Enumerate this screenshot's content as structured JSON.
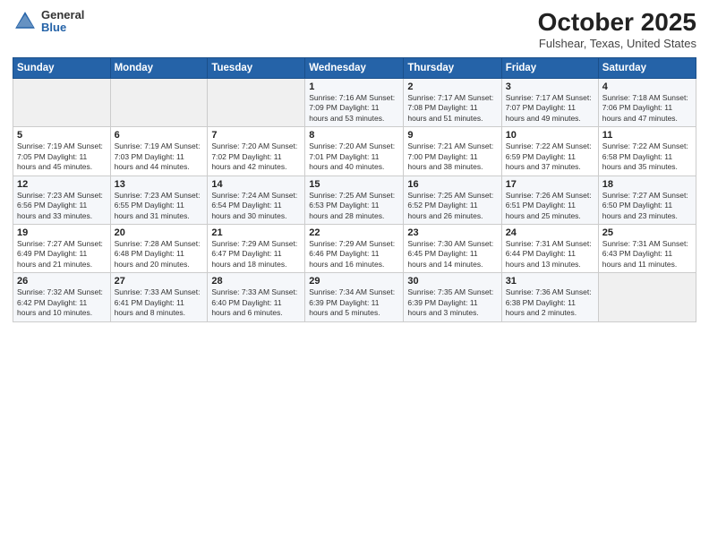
{
  "header": {
    "logo_general": "General",
    "logo_blue": "Blue",
    "month": "October 2025",
    "location": "Fulshear, Texas, United States"
  },
  "days_of_week": [
    "Sunday",
    "Monday",
    "Tuesday",
    "Wednesday",
    "Thursday",
    "Friday",
    "Saturday"
  ],
  "weeks": [
    [
      {
        "num": "",
        "info": ""
      },
      {
        "num": "",
        "info": ""
      },
      {
        "num": "",
        "info": ""
      },
      {
        "num": "1",
        "info": "Sunrise: 7:16 AM\nSunset: 7:09 PM\nDaylight: 11 hours and 53 minutes."
      },
      {
        "num": "2",
        "info": "Sunrise: 7:17 AM\nSunset: 7:08 PM\nDaylight: 11 hours and 51 minutes."
      },
      {
        "num": "3",
        "info": "Sunrise: 7:17 AM\nSunset: 7:07 PM\nDaylight: 11 hours and 49 minutes."
      },
      {
        "num": "4",
        "info": "Sunrise: 7:18 AM\nSunset: 7:06 PM\nDaylight: 11 hours and 47 minutes."
      }
    ],
    [
      {
        "num": "5",
        "info": "Sunrise: 7:19 AM\nSunset: 7:05 PM\nDaylight: 11 hours and 45 minutes."
      },
      {
        "num": "6",
        "info": "Sunrise: 7:19 AM\nSunset: 7:03 PM\nDaylight: 11 hours and 44 minutes."
      },
      {
        "num": "7",
        "info": "Sunrise: 7:20 AM\nSunset: 7:02 PM\nDaylight: 11 hours and 42 minutes."
      },
      {
        "num": "8",
        "info": "Sunrise: 7:20 AM\nSunset: 7:01 PM\nDaylight: 11 hours and 40 minutes."
      },
      {
        "num": "9",
        "info": "Sunrise: 7:21 AM\nSunset: 7:00 PM\nDaylight: 11 hours and 38 minutes."
      },
      {
        "num": "10",
        "info": "Sunrise: 7:22 AM\nSunset: 6:59 PM\nDaylight: 11 hours and 37 minutes."
      },
      {
        "num": "11",
        "info": "Sunrise: 7:22 AM\nSunset: 6:58 PM\nDaylight: 11 hours and 35 minutes."
      }
    ],
    [
      {
        "num": "12",
        "info": "Sunrise: 7:23 AM\nSunset: 6:56 PM\nDaylight: 11 hours and 33 minutes."
      },
      {
        "num": "13",
        "info": "Sunrise: 7:23 AM\nSunset: 6:55 PM\nDaylight: 11 hours and 31 minutes."
      },
      {
        "num": "14",
        "info": "Sunrise: 7:24 AM\nSunset: 6:54 PM\nDaylight: 11 hours and 30 minutes."
      },
      {
        "num": "15",
        "info": "Sunrise: 7:25 AM\nSunset: 6:53 PM\nDaylight: 11 hours and 28 minutes."
      },
      {
        "num": "16",
        "info": "Sunrise: 7:25 AM\nSunset: 6:52 PM\nDaylight: 11 hours and 26 minutes."
      },
      {
        "num": "17",
        "info": "Sunrise: 7:26 AM\nSunset: 6:51 PM\nDaylight: 11 hours and 25 minutes."
      },
      {
        "num": "18",
        "info": "Sunrise: 7:27 AM\nSunset: 6:50 PM\nDaylight: 11 hours and 23 minutes."
      }
    ],
    [
      {
        "num": "19",
        "info": "Sunrise: 7:27 AM\nSunset: 6:49 PM\nDaylight: 11 hours and 21 minutes."
      },
      {
        "num": "20",
        "info": "Sunrise: 7:28 AM\nSunset: 6:48 PM\nDaylight: 11 hours and 20 minutes."
      },
      {
        "num": "21",
        "info": "Sunrise: 7:29 AM\nSunset: 6:47 PM\nDaylight: 11 hours and 18 minutes."
      },
      {
        "num": "22",
        "info": "Sunrise: 7:29 AM\nSunset: 6:46 PM\nDaylight: 11 hours and 16 minutes."
      },
      {
        "num": "23",
        "info": "Sunrise: 7:30 AM\nSunset: 6:45 PM\nDaylight: 11 hours and 14 minutes."
      },
      {
        "num": "24",
        "info": "Sunrise: 7:31 AM\nSunset: 6:44 PM\nDaylight: 11 hours and 13 minutes."
      },
      {
        "num": "25",
        "info": "Sunrise: 7:31 AM\nSunset: 6:43 PM\nDaylight: 11 hours and 11 minutes."
      }
    ],
    [
      {
        "num": "26",
        "info": "Sunrise: 7:32 AM\nSunset: 6:42 PM\nDaylight: 11 hours and 10 minutes."
      },
      {
        "num": "27",
        "info": "Sunrise: 7:33 AM\nSunset: 6:41 PM\nDaylight: 11 hours and 8 minutes."
      },
      {
        "num": "28",
        "info": "Sunrise: 7:33 AM\nSunset: 6:40 PM\nDaylight: 11 hours and 6 minutes."
      },
      {
        "num": "29",
        "info": "Sunrise: 7:34 AM\nSunset: 6:39 PM\nDaylight: 11 hours and 5 minutes."
      },
      {
        "num": "30",
        "info": "Sunrise: 7:35 AM\nSunset: 6:39 PM\nDaylight: 11 hours and 3 minutes."
      },
      {
        "num": "31",
        "info": "Sunrise: 7:36 AM\nSunset: 6:38 PM\nDaylight: 11 hours and 2 minutes."
      },
      {
        "num": "",
        "info": ""
      }
    ]
  ]
}
